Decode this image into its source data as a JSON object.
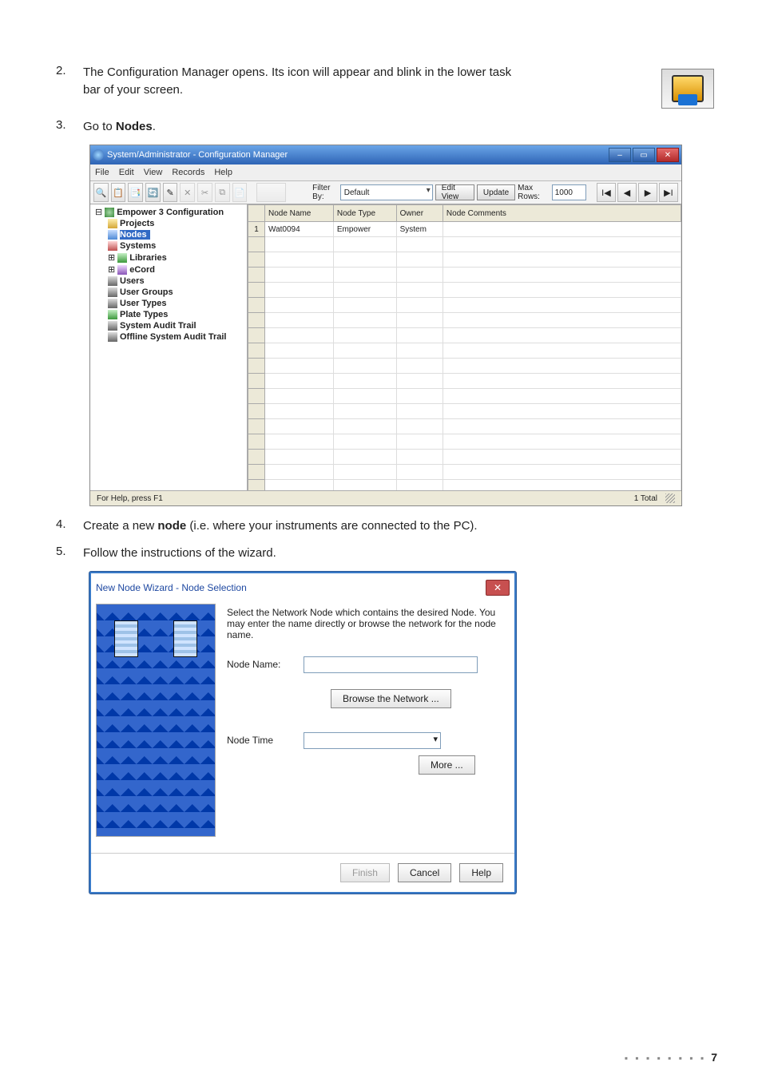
{
  "steps": {
    "s2_num": "2.",
    "s2_text": "The Configuration Manager opens. Its icon will appear and blink in the lower task bar of your screen.",
    "s3_num": "3.",
    "s3_text_a": "Go to ",
    "s3_text_b": "Nodes",
    "s3_text_c": ".",
    "s4_num": "4.",
    "s4_text_a": "Create a new ",
    "s4_text_b": "node",
    "s4_text_c": " (i.e. where your instruments are connected to the PC).",
    "s5_num": "5.",
    "s5_text": "Follow the instructions of the wizard."
  },
  "shot1": {
    "title": "System/Administrator - Configuration Manager",
    "menu": [
      "File",
      "Edit",
      "View",
      "Records",
      "Help"
    ],
    "filter_label": "Filter By:",
    "filter_value": "Default",
    "editview": "Edit View",
    "update": "Update",
    "maxrows_label": "Max Rows:",
    "maxrows_value": "1000",
    "tree": [
      "Empower 3 Configuration",
      "Projects",
      "Nodes",
      "Systems",
      "Libraries",
      "eCord",
      "Users",
      "User Groups",
      "User Types",
      "Plate Types",
      "System Audit Trail",
      "Offline System Audit Trail"
    ],
    "cols": [
      "Node Name",
      "Node Type",
      "Owner",
      "Node Comments"
    ],
    "row": {
      "idx": "1",
      "name": "Wat0094",
      "type": "Empower",
      "owner": "System",
      "comments": ""
    },
    "status_left": "For Help, press F1",
    "status_right": "1 Total"
  },
  "shot2": {
    "title": "New Node Wizard - Node Selection",
    "desc": "Select the Network Node which contains the desired Node.  You may enter the name directly or browse the network for the node name.",
    "name_label": "Node Name:",
    "name_value": "",
    "browse": "Browse the Network ...",
    "time_label": "Node Time",
    "more": "More ...",
    "finish": "Finish",
    "cancel": "Cancel",
    "help": "Help"
  },
  "pagenum_dots": "▪ ▪ ▪ ▪ ▪ ▪ ▪ ▪",
  "pagenum": "7"
}
